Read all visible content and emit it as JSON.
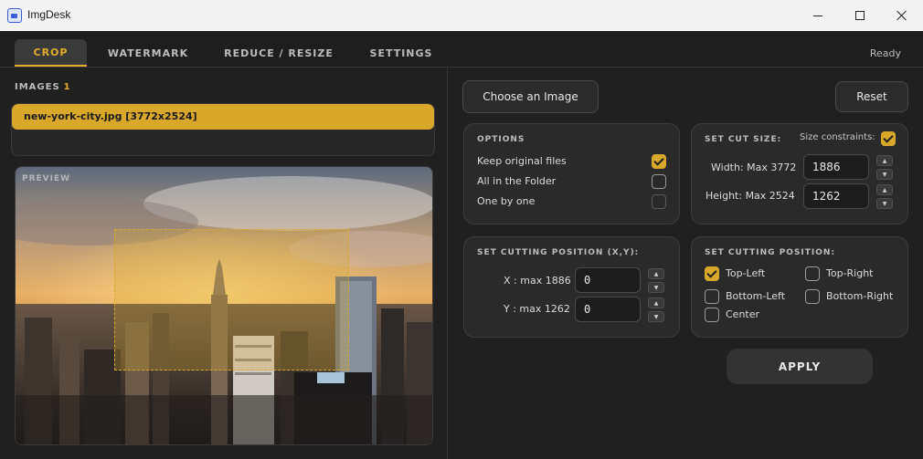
{
  "window": {
    "title": "ImgDesk"
  },
  "tabs": [
    {
      "label": "CROP",
      "active": true
    },
    {
      "label": "WATERMARK",
      "active": false
    },
    {
      "label": "REDUCE / RESIZE",
      "active": false
    },
    {
      "label": "SETTINGS",
      "active": false
    }
  ],
  "status": "Ready",
  "images": {
    "label": "IMAGES",
    "count": "1",
    "files": [
      {
        "name": "new-york-city.jpg [3772x2524]",
        "selected": true
      }
    ]
  },
  "preview": {
    "label": "PREVIEW"
  },
  "buttons": {
    "choose_image": "Choose an Image",
    "reset": "Reset",
    "apply": "APPLY"
  },
  "options": {
    "title": "OPTIONS",
    "items": [
      {
        "label": "Keep original files",
        "checked": true
      },
      {
        "label": "All in the Folder",
        "checked": false
      },
      {
        "label": "One by one",
        "checked": false
      }
    ]
  },
  "cut_size": {
    "title": "SET CUT SIZE:",
    "constraints_label": "Size constraints:",
    "constraints_checked": true,
    "width_label": "Width: Max 3772",
    "width_value": "1886",
    "height_label": "Height: Max 2524",
    "height_value": "1262"
  },
  "cutting_xy": {
    "title": "SET CUTTING POSITION (X,Y):",
    "x_label": "X : max 1886",
    "x_value": "0",
    "y_label": "Y : max 1262",
    "y_value": "0"
  },
  "cutting_position": {
    "title": "SET CUTTING POSITION:",
    "items": [
      {
        "label": "Top-Left",
        "checked": true
      },
      {
        "label": "Top-Right",
        "checked": false
      },
      {
        "label": "Bottom-Left",
        "checked": false
      },
      {
        "label": "Bottom-Right",
        "checked": false
      },
      {
        "label": "Center",
        "checked": false
      }
    ]
  },
  "spinner": {
    "up": "▲",
    "down": "▼"
  },
  "colors": {
    "accent": "#d9a82a",
    "background": "#202020",
    "card": "#2a2a2a"
  }
}
